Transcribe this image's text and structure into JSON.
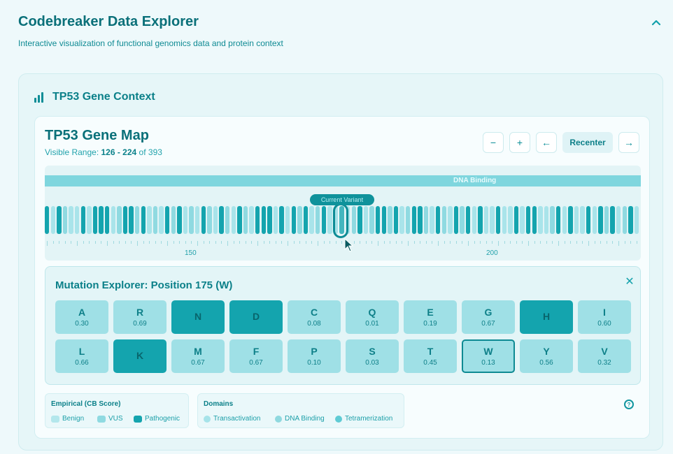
{
  "app": {
    "title": "Codebreaker Data Explorer",
    "subtitle": "Interactive visualization of functional genomics data and protein context"
  },
  "context": {
    "title": "TP53 Gene Context"
  },
  "gene_map": {
    "title": "TP53 Gene Map",
    "range_prefix": "Visible Range: ",
    "range_value": "126 - 224",
    "range_suffix": " of 393",
    "controls": {
      "zoom_out": "−",
      "zoom_in": "+",
      "prev": "←",
      "recenter": "Recenter",
      "next": "→"
    },
    "domain_label": "DNA Binding",
    "current_tag": "Current Variant",
    "axis_labels": [
      "150",
      "200"
    ]
  },
  "explorer": {
    "title": "Mutation Explorer: Position 175 (W)",
    "close_label": "✕",
    "variants": [
      {
        "aa": "A",
        "score": "0.30",
        "class": "vus"
      },
      {
        "aa": "R",
        "score": "0.69",
        "class": "vus"
      },
      {
        "aa": "N",
        "score": "",
        "class": "path"
      },
      {
        "aa": "D",
        "score": "",
        "class": "path"
      },
      {
        "aa": "C",
        "score": "0.08",
        "class": "vus"
      },
      {
        "aa": "Q",
        "score": "0.01",
        "class": "vus"
      },
      {
        "aa": "E",
        "score": "0.19",
        "class": "vus"
      },
      {
        "aa": "G",
        "score": "0.67",
        "class": "vus"
      },
      {
        "aa": "H",
        "score": "",
        "class": "path"
      },
      {
        "aa": "I",
        "score": "0.60",
        "class": "vus"
      },
      {
        "aa": "L",
        "score": "0.66",
        "class": "vus"
      },
      {
        "aa": "K",
        "score": "",
        "class": "path"
      },
      {
        "aa": "M",
        "score": "0.67",
        "class": "vus"
      },
      {
        "aa": "F",
        "score": "0.67",
        "class": "vus"
      },
      {
        "aa": "P",
        "score": "0.10",
        "class": "vus"
      },
      {
        "aa": "S",
        "score": "0.03",
        "class": "vus"
      },
      {
        "aa": "T",
        "score": "0.45",
        "class": "vus"
      },
      {
        "aa": "W",
        "score": "0.13",
        "class": "vus",
        "selected": true
      },
      {
        "aa": "Y",
        "score": "0.56",
        "class": "vus"
      },
      {
        "aa": "V",
        "score": "0.32",
        "class": "vus"
      }
    ]
  },
  "legend": {
    "empirical_title": "Empirical (CB Score)",
    "empirical_items": [
      {
        "label": "Benign",
        "color": "#b3e7ec"
      },
      {
        "label": "VUS",
        "color": "#8fdae1"
      },
      {
        "label": "Pathogenic",
        "color": "#14a4ae"
      }
    ],
    "domains_title": "Domains",
    "domain_items": [
      {
        "label": "Transactivation",
        "color": "#a6e3e9"
      },
      {
        "label": "DNA Binding",
        "color": "#8fd9df"
      },
      {
        "label": "Tetramerization",
        "color": "#5fcbd4"
      }
    ],
    "help_label": "?"
  },
  "colors": {
    "accent": "#0b8089",
    "pathogenic": "#14a4ae",
    "vus": "#9fe0e6",
    "benign": "#b7e9ee"
  }
}
